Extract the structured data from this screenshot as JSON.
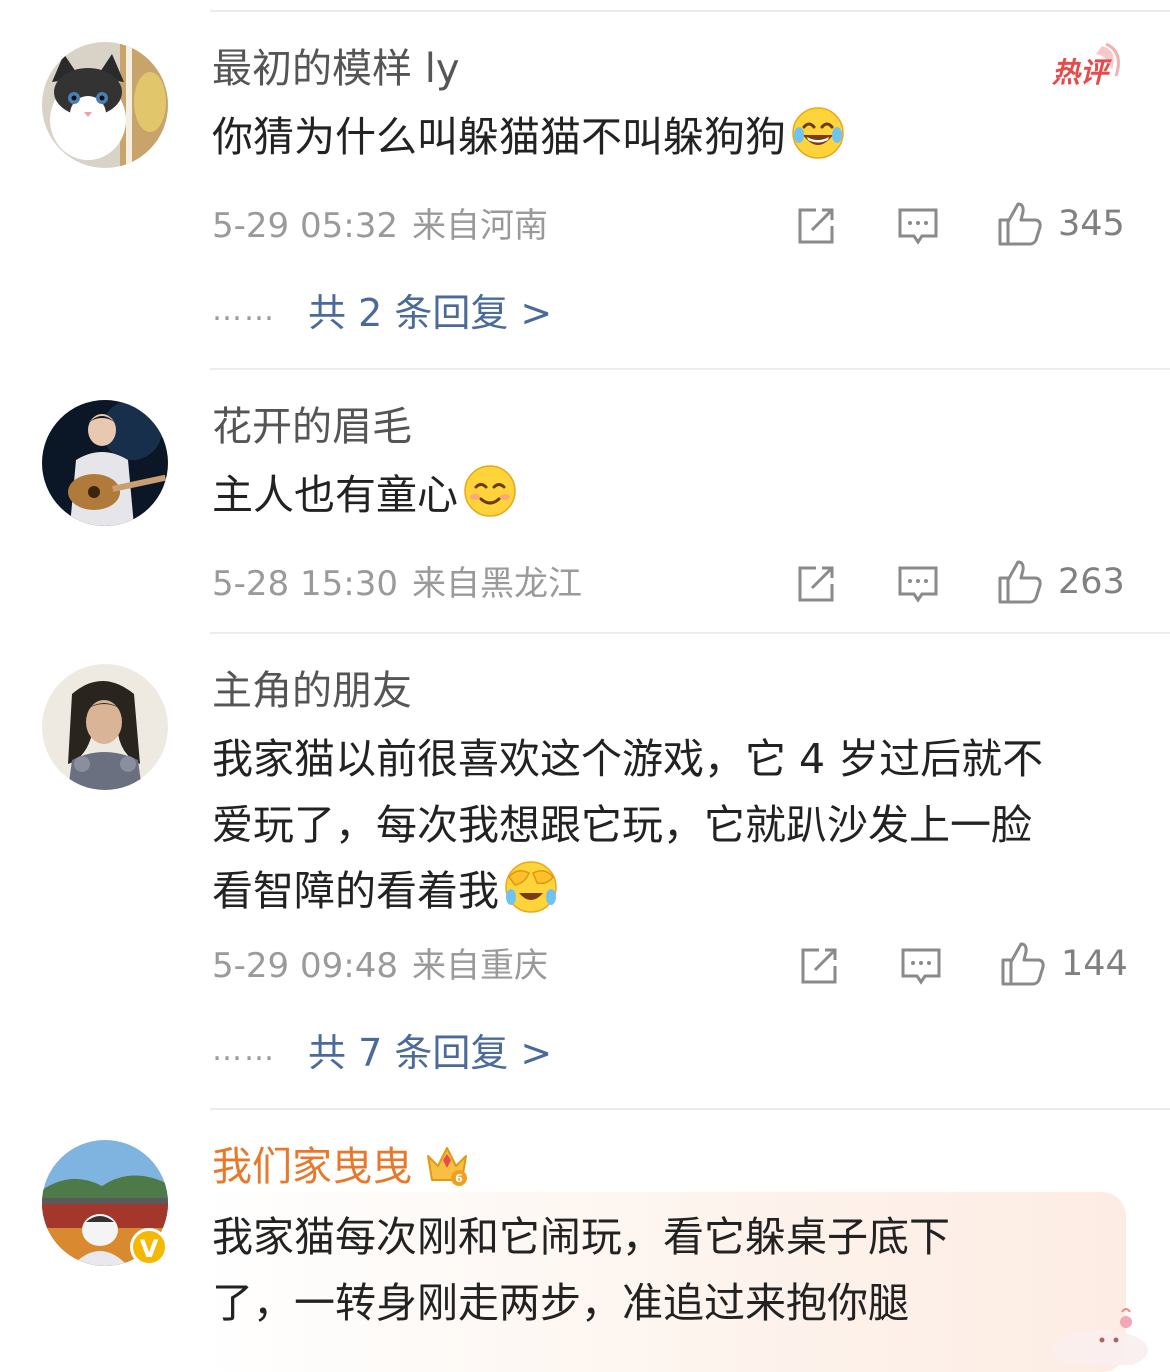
{
  "comments": [
    {
      "username": "最初的模样 ly",
      "text": "你猜为什么叫躲猫猫不叫躲狗狗",
      "emoji": "laughing-tears-emoji",
      "time": "5-29 05:32",
      "location": "来自河南",
      "likes": "345",
      "replies_label": "共 2 条回复 >",
      "hot_badge": "热评"
    },
    {
      "username": "花开的眉毛",
      "text": "主人也有童心",
      "emoji": "smile-emoji",
      "time": "5-28 15:30",
      "location": "来自黑龙江",
      "likes": "263"
    },
    {
      "username": "主角的朋友",
      "text_lines": [
        "我家猫以前很喜欢这个游戏，它 4 岁过后就不",
        "爱玩了，每次我想跟它玩，它就趴沙发上一脸",
        "看智障的看着我"
      ],
      "emoji": "facepalm-laugh-emoji",
      "time": "5-29 09:48",
      "location": "来自重庆",
      "likes": "144",
      "replies_label": "共 7 条回复 >"
    },
    {
      "username": "我们家曳曳",
      "text_lines": [
        "我家猫每次刚和它闹玩，看它躲桌子底下",
        "了，一转身刚走两步，准追过来抱你腿"
      ],
      "vip_badge": "6",
      "verified_badge": "V"
    }
  ],
  "icons": {
    "repost": "share-square-icon",
    "comment": "comment-bubble-icon",
    "like": "thumbs-up-icon"
  },
  "colors": {
    "username": "#555555",
    "vip_username": "#e8782a",
    "replies_link": "#4a6a99",
    "hot_badge": "#e84a4a"
  },
  "dots": "……"
}
